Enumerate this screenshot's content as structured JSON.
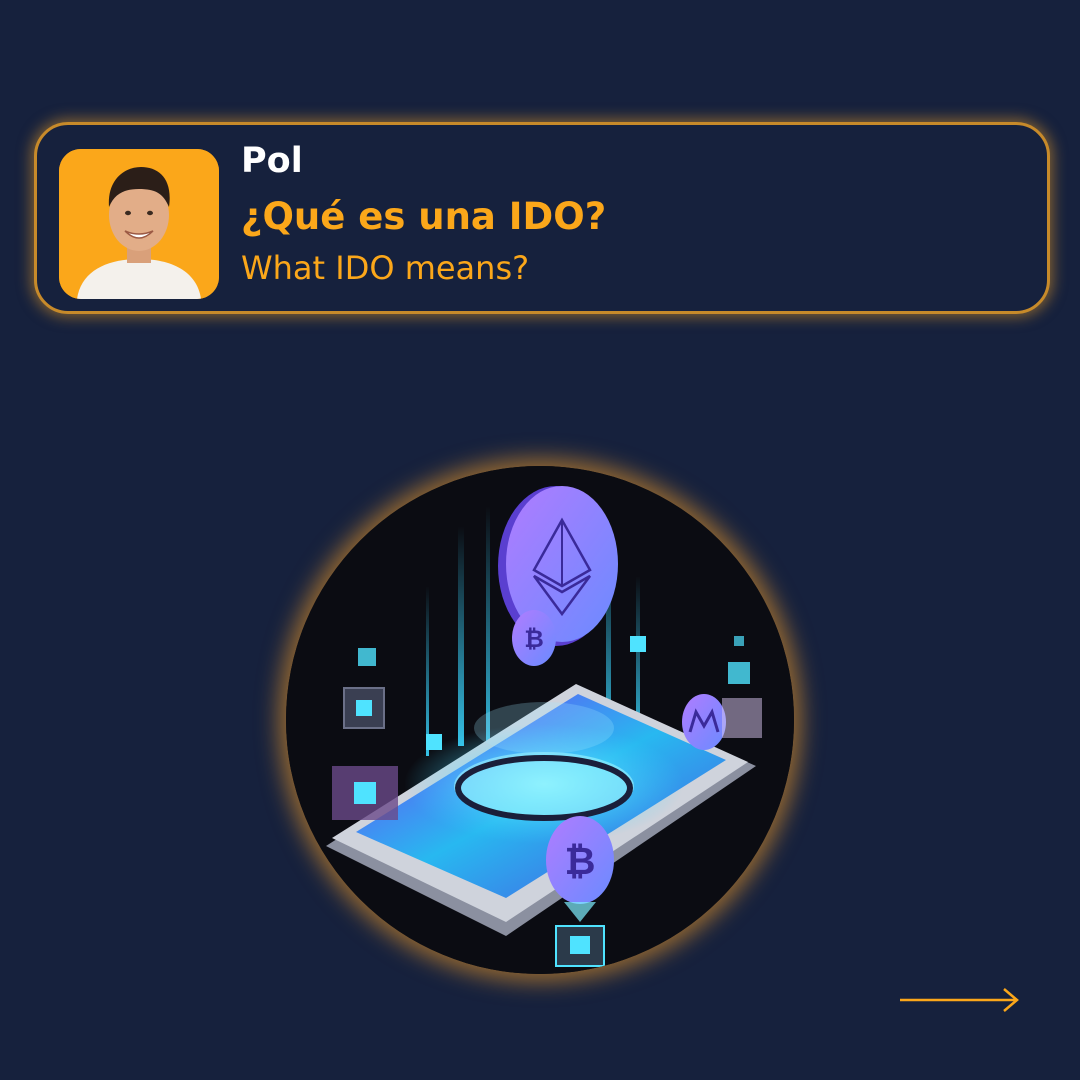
{
  "post": {
    "author_name": "Pol",
    "title": "¿Qué es una IDO?",
    "subtitle": "What IDO means?"
  },
  "colors": {
    "background": "#16213d",
    "accent": "#fba71a",
    "card_border": "#c78a2a"
  },
  "icons": {
    "avatar": "person-photo",
    "hero": "crypto-phone-illustration",
    "next": "arrow-right-icon"
  }
}
